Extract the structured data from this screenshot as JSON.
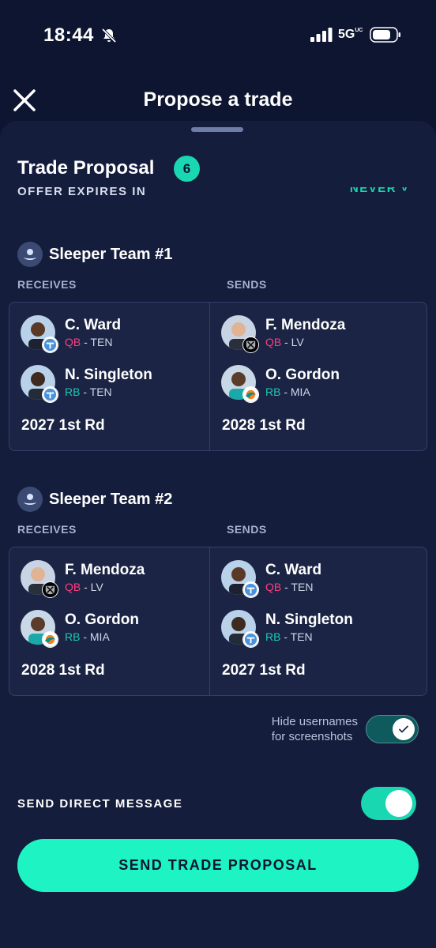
{
  "status_bar": {
    "time": "18:44",
    "network": "5G",
    "network_suffix": "UC"
  },
  "header": {
    "title": "Propose a trade"
  },
  "proposal": {
    "title": "Trade Proposal",
    "count": "6",
    "expires_label": "OFFER EXPIRES IN",
    "expires_value": "NEVER ˅"
  },
  "teams": [
    {
      "name": "Sleeper Team #1",
      "receives_label": "RECEIVES",
      "sends_label": "SENDS",
      "receives": [
        {
          "name": "C. Ward",
          "pos": "QB",
          "team": " - TEN",
          "badge": "titans-badge"
        },
        {
          "name": "N. Singleton",
          "pos": "RB",
          "team": " - TEN",
          "badge": "titans-badge"
        }
      ],
      "receives_pick": "2027 1st Rd",
      "sends": [
        {
          "name": "F. Mendoza",
          "pos": "QB",
          "team": " - LV",
          "badge": "raiders-badge"
        },
        {
          "name": "O. Gordon",
          "pos": "RB",
          "team": " - MIA",
          "badge": "dolphins-badge"
        }
      ],
      "sends_pick": "2028 1st Rd"
    },
    {
      "name": "Sleeper Team #2",
      "receives_label": "RECEIVES",
      "sends_label": "SENDS",
      "receives": [
        {
          "name": "F. Mendoza",
          "pos": "QB",
          "team": " - LV",
          "badge": "raiders-badge"
        },
        {
          "name": "O. Gordon",
          "pos": "RB",
          "team": " - MIA",
          "badge": "dolphins-badge"
        }
      ],
      "receives_pick": "2028 1st Rd",
      "sends": [
        {
          "name": "C. Ward",
          "pos": "QB",
          "team": " - TEN",
          "badge": "titans-badge"
        },
        {
          "name": "N. Singleton",
          "pos": "RB",
          "team": " - TEN",
          "badge": "titans-badge"
        }
      ],
      "sends_pick": "2027 1st Rd"
    }
  ],
  "hide_usernames": {
    "line1": "Hide usernames",
    "line2": "for screenshots",
    "enabled": true
  },
  "direct_message": {
    "label": "SEND DIRECT MESSAGE",
    "enabled": true
  },
  "submit": {
    "label": "SEND TRADE PROPOSAL"
  },
  "colors": {
    "background": "#0d1530",
    "sheet": "#151d3c",
    "accent": "#19d7b0",
    "button": "#1df3c3",
    "qb": "#ff3d7f",
    "rb": "#1ec7b0"
  }
}
